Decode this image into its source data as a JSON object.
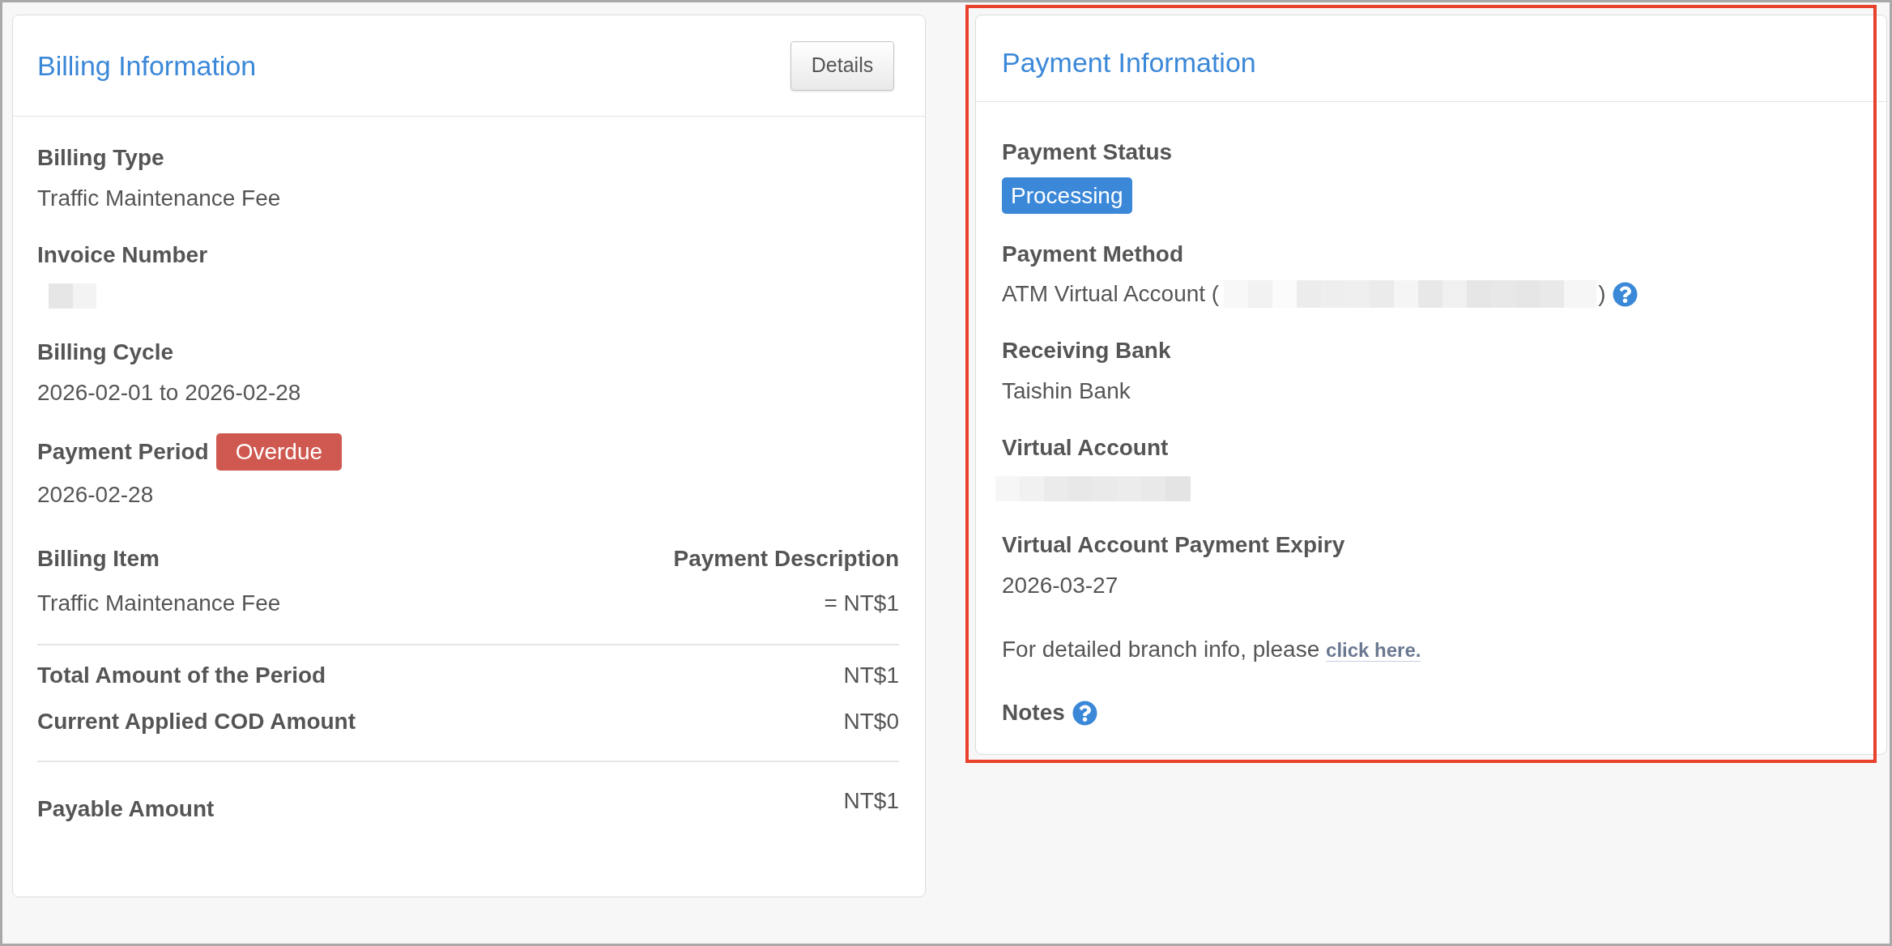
{
  "billing": {
    "title": "Billing Information",
    "details_button": "Details",
    "fields": [
      {
        "kind": "text",
        "label": "Billing Type",
        "value": "Traffic Maintenance Fee"
      },
      {
        "kind": "redacted",
        "label": "Invoice Number"
      },
      {
        "kind": "text",
        "label": "Billing Cycle",
        "value": "2026-02-01 to 2026-02-28"
      },
      {
        "kind": "label_badge",
        "label": "Payment Period",
        "badge": "Overdue",
        "color": "#cf5850",
        "value": "2026-02-28"
      }
    ],
    "items_table": {
      "columns": [
        "Billing Item",
        "Payment Description"
      ],
      "rows": [
        [
          "Traffic Maintenance Fee",
          "= NT$1"
        ]
      ]
    },
    "totals": [
      {
        "label": "Total Amount of the Period",
        "value": "NT$1"
      },
      {
        "label": "Current Applied COD Amount",
        "value": "NT$0"
      }
    ],
    "payable": {
      "label": "Payable Amount",
      "value": "NT$1"
    }
  },
  "payment": {
    "title": "Payment Information",
    "fields": [
      {
        "kind": "badge",
        "label": "Payment Status",
        "badge": "Processing",
        "color": "#3b88d8"
      },
      {
        "kind": "method",
        "label": "Payment Method",
        "prefix": "ATM Virtual Account (",
        "suffix": ")"
      },
      {
        "kind": "text",
        "label": "Receiving Bank",
        "value": "Taishin Bank"
      },
      {
        "kind": "redacted",
        "label": "Virtual Account"
      },
      {
        "kind": "text",
        "label": "Virtual Account Payment Expiry",
        "value": "2026-03-27"
      }
    ],
    "branch_note": {
      "text": "For detailed branch info, please",
      "link": "click here."
    },
    "notes": {
      "label": "Notes"
    }
  }
}
